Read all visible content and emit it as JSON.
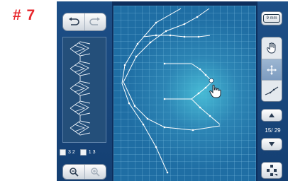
{
  "step": {
    "label": "# 7"
  },
  "left_panel": {
    "stitch_count": "3 2",
    "info_value": "1 3"
  },
  "right_panel": {
    "size_label": "9 mm",
    "counter": "15/ 29",
    "tools": [
      "hand-icon",
      "move-icon",
      "stitch-edit-icon"
    ]
  },
  "colors": {
    "accent_red": "#e8262b",
    "panel_blue": "#1d4f87",
    "canvas_blue": "#1f6ea4",
    "canvas_glow": "#4fc8de"
  }
}
